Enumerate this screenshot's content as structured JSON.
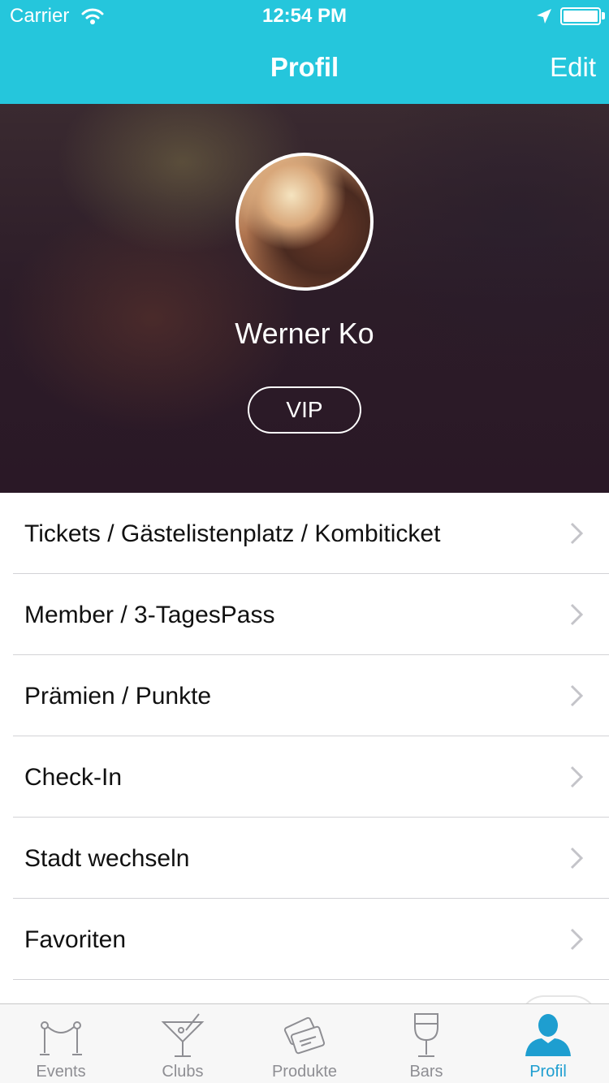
{
  "status_bar": {
    "carrier": "Carrier",
    "time": "12:54 PM"
  },
  "nav": {
    "title": "Profil",
    "edit_label": "Edit"
  },
  "profile": {
    "name": "Werner Ko",
    "badge": "VIP"
  },
  "menu": [
    {
      "label": "Tickets / Gästelistenplatz / Kombiticket"
    },
    {
      "label": "Member / 3-TagesPass"
    },
    {
      "label": "Prämien / Punkte"
    },
    {
      "label": "Check-In"
    },
    {
      "label": "Stadt wechseln"
    },
    {
      "label": "Favoriten"
    }
  ],
  "tabs": [
    {
      "label": "Events",
      "icon": "rope-barrier-icon"
    },
    {
      "label": "Clubs",
      "icon": "cocktail-glass-icon"
    },
    {
      "label": "Produkte",
      "icon": "tickets-icon"
    },
    {
      "label": "Bars",
      "icon": "wine-glass-icon"
    },
    {
      "label": "Profil",
      "icon": "person-icon",
      "active": true
    }
  ],
  "colors": {
    "accent": "#25c6dc",
    "tab_active": "#1e9ed0",
    "tab_inactive": "#8e8e93"
  }
}
